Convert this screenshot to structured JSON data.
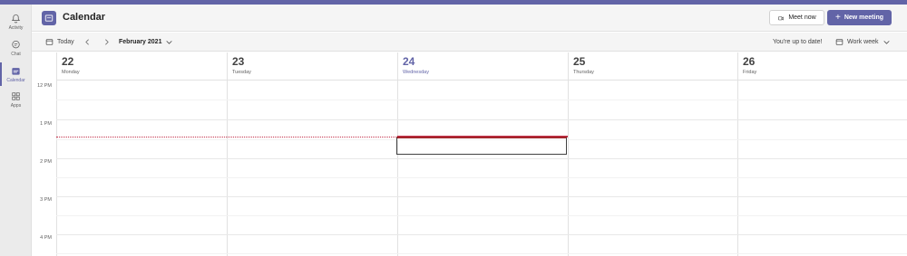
{
  "rail": {
    "items": [
      {
        "label": "Activity",
        "icon": "bell-icon"
      },
      {
        "label": "Chat",
        "icon": "chat-icon"
      },
      {
        "label": "Calendar",
        "icon": "calendar-icon",
        "active": true
      },
      {
        "label": "Apps",
        "icon": "apps-icon"
      }
    ]
  },
  "header": {
    "title": "Calendar",
    "meet_now": "Meet now",
    "new_meeting": "New meeting"
  },
  "toolbar": {
    "today": "Today",
    "month": "February 2021",
    "status": "You're up to date!",
    "view": "Work week"
  },
  "days": [
    {
      "num": "22",
      "name": "Monday"
    },
    {
      "num": "23",
      "name": "Tuesday"
    },
    {
      "num": "24",
      "name": "Wednesday",
      "today": true
    },
    {
      "num": "25",
      "name": "Thursday"
    },
    {
      "num": "26",
      "name": "Friday"
    }
  ],
  "times": [
    "12 PM",
    "1 PM",
    "2 PM",
    "3 PM",
    "4 PM"
  ],
  "colors": {
    "accent": "#6264a7",
    "now": "#c4314b"
  }
}
